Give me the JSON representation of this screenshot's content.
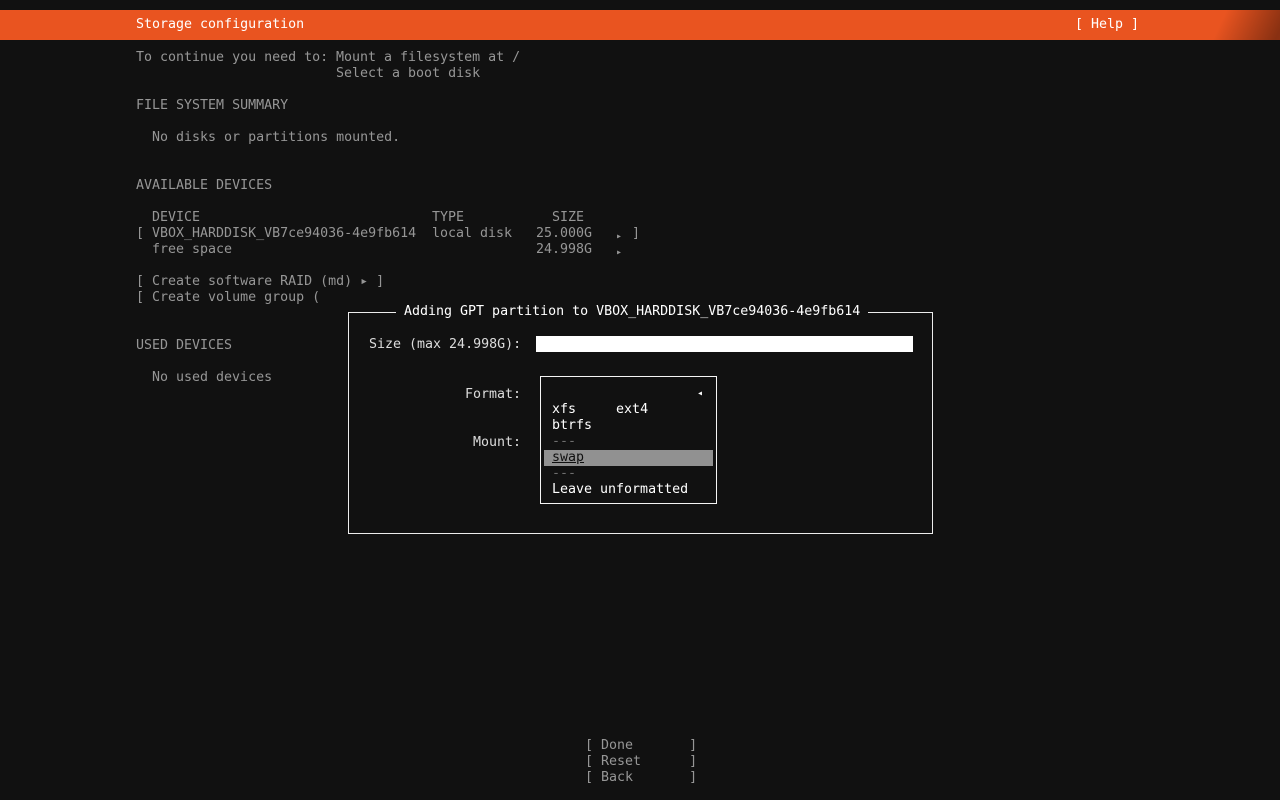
{
  "titlebar": {
    "title": "Storage configuration",
    "help_label": "[ Help ]"
  },
  "instructions": {
    "prefix": "To continue you need to:",
    "line1": "Mount a filesystem at /",
    "line2": "Select a boot disk"
  },
  "sections": {
    "fs_summary_heading": "FILE SYSTEM SUMMARY",
    "fs_summary_empty": "No disks or partitions mounted.",
    "available_heading": "AVAILABLE DEVICES",
    "used_heading": "USED DEVICES",
    "used_empty": "No used devices"
  },
  "device_table": {
    "headers": {
      "device": "DEVICE",
      "type": "TYPE",
      "size": "SIZE"
    },
    "rows": [
      {
        "open": "[",
        "device": "VBOX_HARDDISK_VB7ce94036-4e9fb614",
        "type": "local disk",
        "size": "25.000G",
        "arrow": "▸",
        "close": "]"
      },
      {
        "device": "free space",
        "size": "24.998G",
        "arrow": "▸"
      }
    ]
  },
  "actions": {
    "create_raid": "[ Create software RAID (md) ▸ ]",
    "create_vg": "[ Create volume group ("
  },
  "dialog": {
    "title": "Adding GPT partition to VBOX_HARDDISK_VB7ce94036-4e9fb614",
    "size_label": "Size (max 24.998G):",
    "size_value": "",
    "format_label": "Format:",
    "mount_label": "Mount:",
    "dropdown": {
      "selected_arrow": "◂",
      "options": [
        {
          "label": "ext4",
          "state": "normal"
        },
        {
          "label": "xfs",
          "state": "normal"
        },
        {
          "label": "btrfs",
          "state": "normal"
        },
        {
          "label": "---",
          "state": "dim"
        },
        {
          "label": "swap",
          "state": "highlighted"
        },
        {
          "label": "---",
          "state": "dim"
        },
        {
          "label": "Leave unformatted",
          "state": "normal"
        }
      ]
    }
  },
  "footer": {
    "done": "[ Done       ]",
    "reset": "[ Reset      ]",
    "back": "[ Back       ]"
  },
  "colors": {
    "accent_orange": "#e95420",
    "background": "#111111",
    "text_dim": "#969696",
    "text_bright": "#dcdcdc",
    "white": "#ffffff",
    "highlight_bg": "#919191"
  }
}
